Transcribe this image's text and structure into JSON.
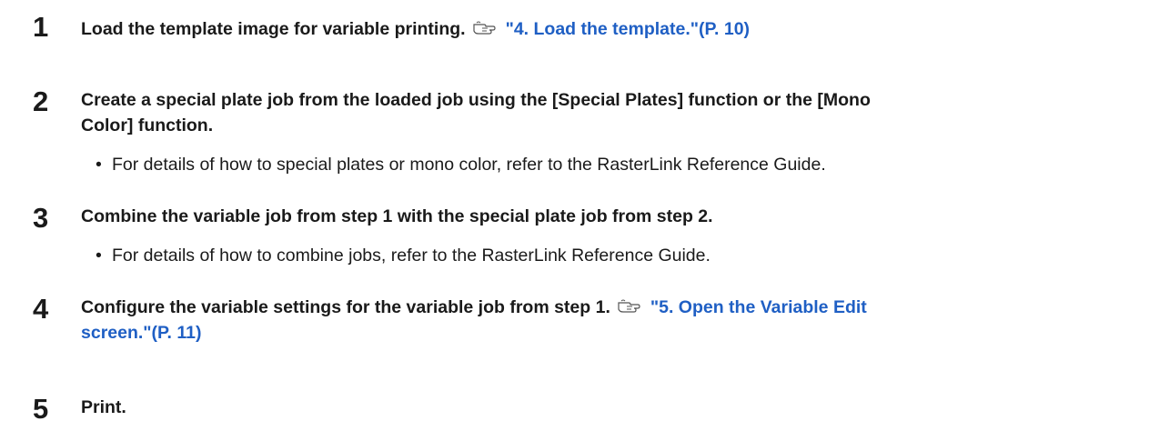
{
  "steps": [
    {
      "number": "1",
      "text": "Load the template image for variable printing.",
      "ref_icon": "reference-hand-icon",
      "link": "\"4. Load the template.\"(P. 10)"
    },
    {
      "number": "2",
      "text_line1": "Create a special plate job from the loaded job using the [Special Plates] function or the [Mono",
      "text_line2": "Color] function.",
      "bullet": "For details of how to special plates or mono color, refer to the RasterLink Reference Guide."
    },
    {
      "number": "3",
      "text": "Combine the variable job from step 1 with the special plate job from step 2.",
      "bullet": "For details of how to combine jobs, refer to the RasterLink Reference Guide."
    },
    {
      "number": "4",
      "text": "Configure the variable settings for the variable job from step 1.",
      "ref_icon": "reference-hand-icon",
      "link_line1": "\"5. Open the Variable Edit",
      "link_line2": "screen.\"(P. 11)"
    },
    {
      "number": "5",
      "text": "Print."
    }
  ],
  "bullet_symbol": "•",
  "colors": {
    "text": "#1a1a1a",
    "link": "#1f5fc4"
  }
}
